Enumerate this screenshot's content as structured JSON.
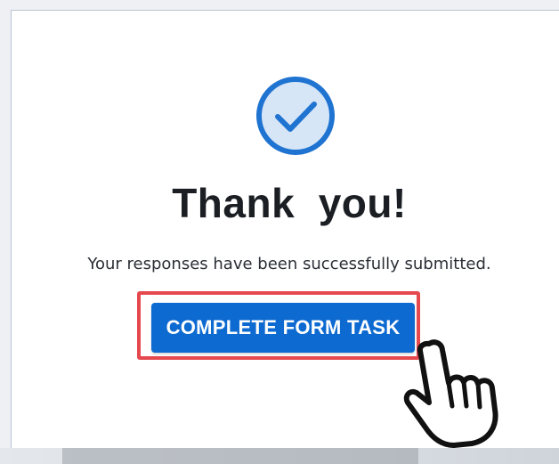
{
  "confirmation": {
    "title": "Thank  you!",
    "message": "Your responses have been successfully submitted.",
    "action_label": "COMPLETE FORM TASK"
  },
  "icons": {
    "status": "check-circle-icon",
    "cursor": "hand-pointer-icon"
  },
  "colors": {
    "accent": "#0d6ad1",
    "check_ring": "#1f73d1",
    "check_fill": "#d6e6f7",
    "highlight": "#e5484d",
    "title_text": "#1b1f24"
  }
}
